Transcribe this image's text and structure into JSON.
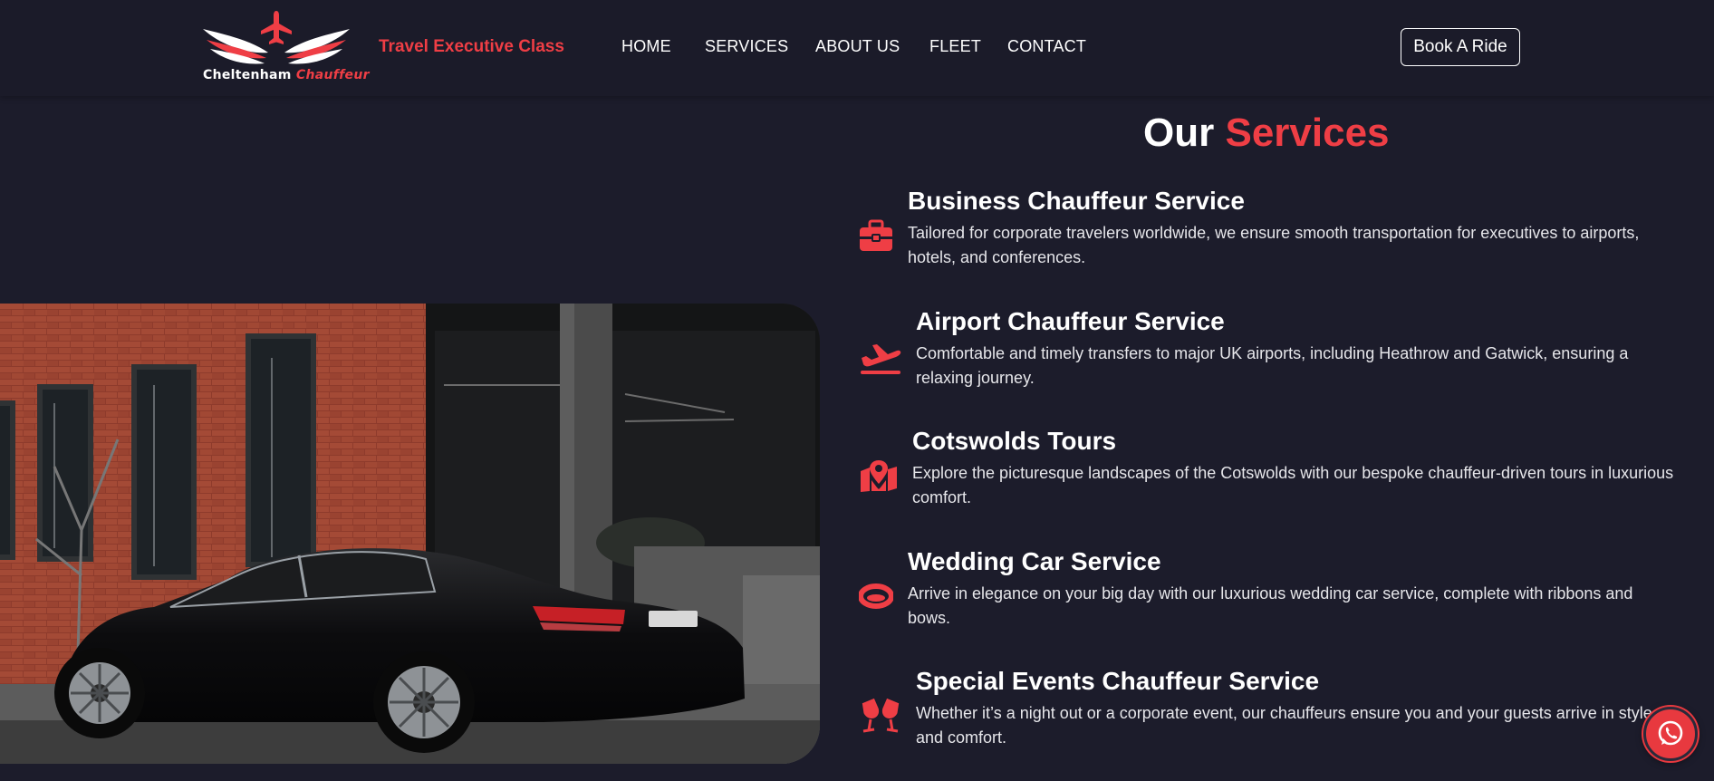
{
  "header": {
    "logo": {
      "text_white": "Cheltenham",
      "text_red": "Chauffeur"
    },
    "tagline": "Travel Executive Class",
    "nav": [
      {
        "label": "HOME"
      },
      {
        "label": "SERVICES"
      },
      {
        "label": "ABOUT US"
      },
      {
        "label": "FLEET"
      },
      {
        "label": "CONTACT"
      }
    ],
    "cta_label": "Book A Ride"
  },
  "section": {
    "title_plain": "Our",
    "title_highlight": "Services"
  },
  "services": [
    {
      "icon": "briefcase-icon",
      "title": "Business Chauffeur Service",
      "description": "Tailored for corporate travelers worldwide, we ensure smooth transportation for executives to airports, hotels, and conferences."
    },
    {
      "icon": "plane-departure-icon",
      "title": "Airport Chauffeur Service",
      "description": "Comfortable and timely transfers to major UK airports, including Heathrow and Gatwick, ensuring a relaxing journey."
    },
    {
      "icon": "map-location-icon",
      "title": "Cotswolds Tours",
      "description": "Explore the picturesque landscapes of the Cotswolds with our bespoke chauffeur-driven tours in luxurious comfort."
    },
    {
      "icon": "ring-icon",
      "title": "Wedding Car Service",
      "description": "Arrive in elegance on your big day with our luxurious wedding car service, complete with ribbons and bows."
    },
    {
      "icon": "champagne-glasses-icon",
      "title": "Special Events Chauffeur Service",
      "description": "Whether it’s a night out or a corporate event, our chauffeurs ensure you and your guests arrive in style and comfort."
    }
  ],
  "colors": {
    "background": "#1c1c2b",
    "accent": "#ef3e45",
    "text": "#ffffff"
  },
  "floating": {
    "icon": "whatsapp-icon"
  }
}
